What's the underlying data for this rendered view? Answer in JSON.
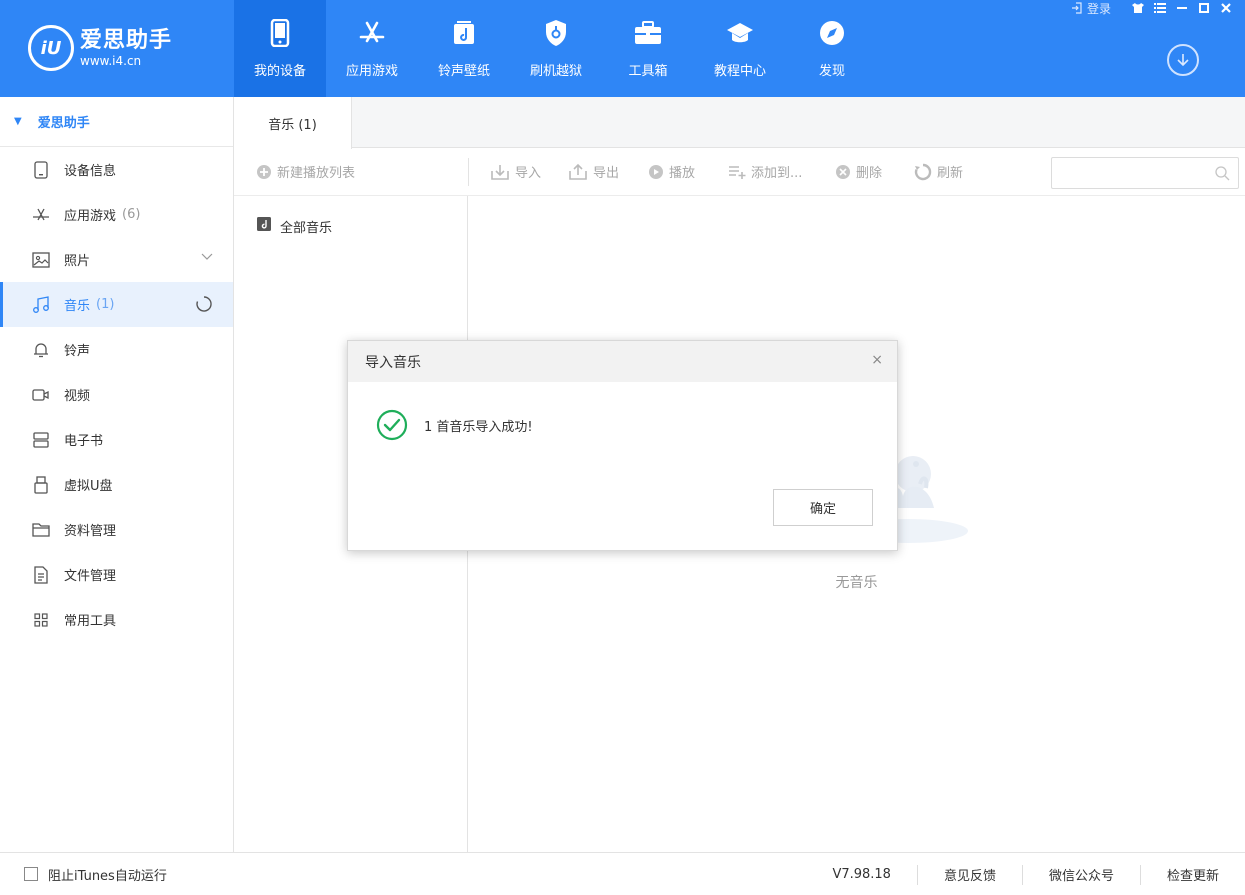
{
  "app": {
    "logo_mark": "iU",
    "name": "爱思助手",
    "url": "www.i4.cn"
  },
  "topbar": {
    "login_label": "登录"
  },
  "nav": {
    "items": [
      {
        "label": "我的设备",
        "icon": "phone-icon"
      },
      {
        "label": "应用游戏",
        "icon": "app-store-icon"
      },
      {
        "label": "铃声壁纸",
        "icon": "music-note-icon"
      },
      {
        "label": "刷机越狱",
        "icon": "shield-icon"
      },
      {
        "label": "工具箱",
        "icon": "toolbox-icon"
      },
      {
        "label": "教程中心",
        "icon": "graduation-cap-icon"
      },
      {
        "label": "发现",
        "icon": "compass-icon"
      }
    ],
    "active_index": 0
  },
  "sidebar": {
    "root_label": "爱思助手",
    "items": [
      {
        "label": "设备信息",
        "count": ""
      },
      {
        "label": "应用游戏",
        "count": "(6)"
      },
      {
        "label": "照片",
        "count": ""
      },
      {
        "label": "音乐",
        "count": "(1)"
      },
      {
        "label": "铃声",
        "count": ""
      },
      {
        "label": "视频",
        "count": ""
      },
      {
        "label": "电子书",
        "count": ""
      },
      {
        "label": "虚拟U盘",
        "count": ""
      },
      {
        "label": "资料管理",
        "count": ""
      },
      {
        "label": "文件管理",
        "count": ""
      },
      {
        "label": "常用工具",
        "count": ""
      }
    ],
    "active_index": 3
  },
  "tabs": {
    "music_tab": "音乐 (1)"
  },
  "toolbar": {
    "new_playlist": "新建播放列表",
    "import": "导入",
    "export": "导出",
    "play": "播放",
    "add_to": "添加到...",
    "delete": "删除",
    "refresh": "刷新",
    "search_placeholder": ""
  },
  "playlist": {
    "all_music": "全部音乐"
  },
  "content": {
    "empty_text": "无音乐"
  },
  "dialog": {
    "title": "导入音乐",
    "close": "×",
    "message": "1 首音乐导入成功!",
    "ok": "确定"
  },
  "footer": {
    "block_itunes": "阻止iTunes自动运行",
    "version": "V7.98.18",
    "feedback": "意见反馈",
    "wechat": "微信公众号",
    "check_update": "检查更新"
  },
  "colors": {
    "brand": "#2f86f6",
    "success": "#1fae5a"
  }
}
